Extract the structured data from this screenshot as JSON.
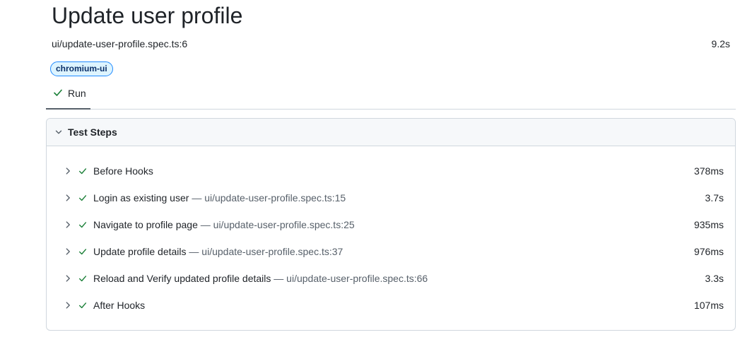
{
  "header": {
    "title": "Update user profile",
    "file_location": "ui/update-user-profile.spec.ts:6",
    "duration": "9.2s",
    "project_badge": "chromium-ui"
  },
  "tabs": [
    {
      "label": "Run",
      "status": "passed"
    }
  ],
  "panel": {
    "title": "Test Steps",
    "steps": [
      {
        "title": "Before Hooks",
        "location": "",
        "duration": "378ms"
      },
      {
        "title": "Login as existing user",
        "location": "— ui/update-user-profile.spec.ts:15",
        "duration": "3.7s"
      },
      {
        "title": "Navigate to profile page",
        "location": "— ui/update-user-profile.spec.ts:25",
        "duration": "935ms"
      },
      {
        "title": "Update profile details",
        "location": "— ui/update-user-profile.spec.ts:37",
        "duration": "976ms"
      },
      {
        "title": "Reload and Verify updated profile details",
        "location": "— ui/update-user-profile.spec.ts:66",
        "duration": "3.3s"
      },
      {
        "title": "After Hooks",
        "location": "",
        "duration": "107ms"
      }
    ]
  },
  "colors": {
    "success": "#1a7f37",
    "badge_bg": "#ddf4ff",
    "badge_border": "#218bff",
    "border": "#d0d7de"
  },
  "icons": {
    "step_expand": "chevron-right-icon",
    "step_status": "check-icon",
    "panel_toggle": "chevron-down-icon"
  }
}
